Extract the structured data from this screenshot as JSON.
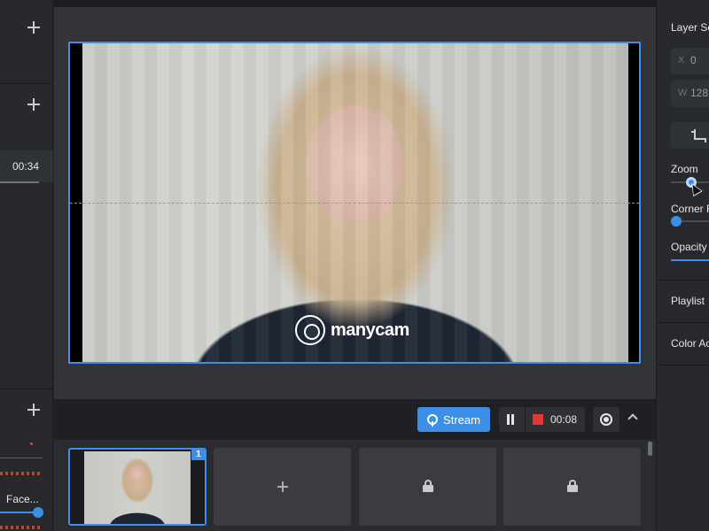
{
  "left_panel": {
    "timer": "00:34",
    "source_label": "Face..."
  },
  "preview": {
    "watermark_text": "manycam"
  },
  "controls": {
    "stream_label": "Stream",
    "recording_time": "00:08"
  },
  "tray": {
    "active_badge": "1"
  },
  "right_panel": {
    "section_title": "Layer Se",
    "x_label": "X",
    "x_value": "0",
    "w_label": "W",
    "w_value": "128",
    "zoom_label": "Zoom",
    "corner_label": "Corner R",
    "opacity_label": "Opacity",
    "playlist_label": "Playlist",
    "color_label": "Color Ac"
  },
  "colors": {
    "accent": "#3c8fe6",
    "record": "#e83535",
    "panel": "#27292d"
  }
}
